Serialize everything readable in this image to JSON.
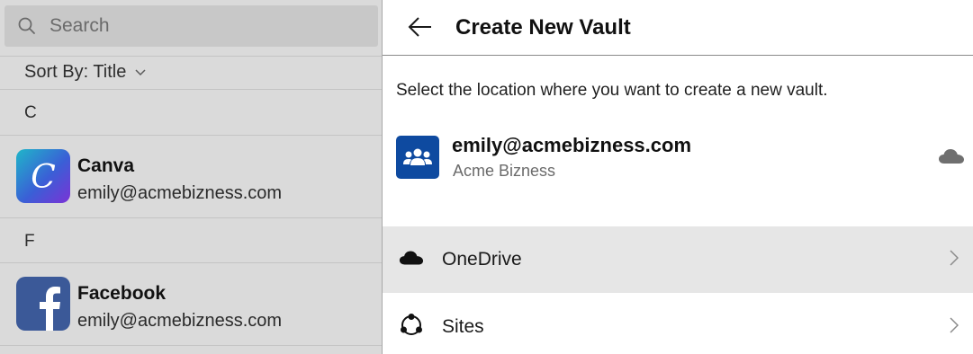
{
  "search": {
    "placeholder": "Search"
  },
  "sort": {
    "label": "Sort By: Title"
  },
  "groups": [
    {
      "letter": "C",
      "items": [
        {
          "title": "Canva",
          "subtitle": "emily@acmebizness.com",
          "icon": "canva-icon"
        }
      ]
    },
    {
      "letter": "F",
      "items": [
        {
          "title": "Facebook",
          "subtitle": "emily@acmebizness.com",
          "icon": "facebook-icon"
        }
      ]
    }
  ],
  "header": {
    "title": "Create New Vault",
    "back_icon": "back-arrow-icon"
  },
  "instruction": "Select the location where you want to create a new vault.",
  "account": {
    "email": "emily@acmebizness.com",
    "org": "Acme Bizness",
    "icon": "group-icon",
    "cloud_icon": "cloud-icon"
  },
  "locations": [
    {
      "label": "OneDrive",
      "icon": "onedrive-icon",
      "selected": true
    },
    {
      "label": "Sites",
      "icon": "sites-icon",
      "selected": false
    }
  ],
  "colors": {
    "account_icon_bg": "#0e4aa0",
    "facebook_blue": "#3b5998",
    "selected_row": "#e6e6e6"
  }
}
